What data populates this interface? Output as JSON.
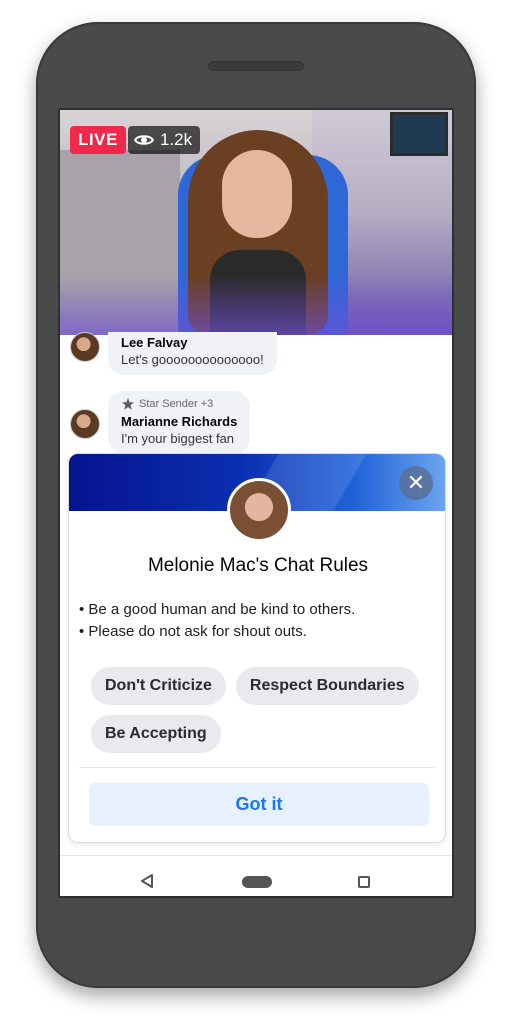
{
  "stream": {
    "live_label": "LIVE",
    "viewer_count": "1.2k"
  },
  "comments": [
    {
      "name": "Lee Falvay",
      "text": "Let's goooooooooooooo!"
    },
    {
      "badge": "Star Sender +3",
      "name": "Marianne Richards",
      "text": "I'm your biggest fan"
    }
  ],
  "dialog": {
    "title": "Melonie Mac's Chat Rules",
    "rules": [
      "Be a good human and be kind to others.",
      "Please do not ask for shout outs."
    ],
    "chips": [
      "Don't Criticize",
      "Respect Boundaries",
      "Be Accepting"
    ],
    "confirm_label": "Got it"
  },
  "colors": {
    "live_red": "#f02849",
    "accent_blue": "#1877f2",
    "banner_dark": "#07138f"
  },
  "icons": {
    "eye": "eye-icon",
    "star": "star-icon",
    "close": "close-icon"
  }
}
